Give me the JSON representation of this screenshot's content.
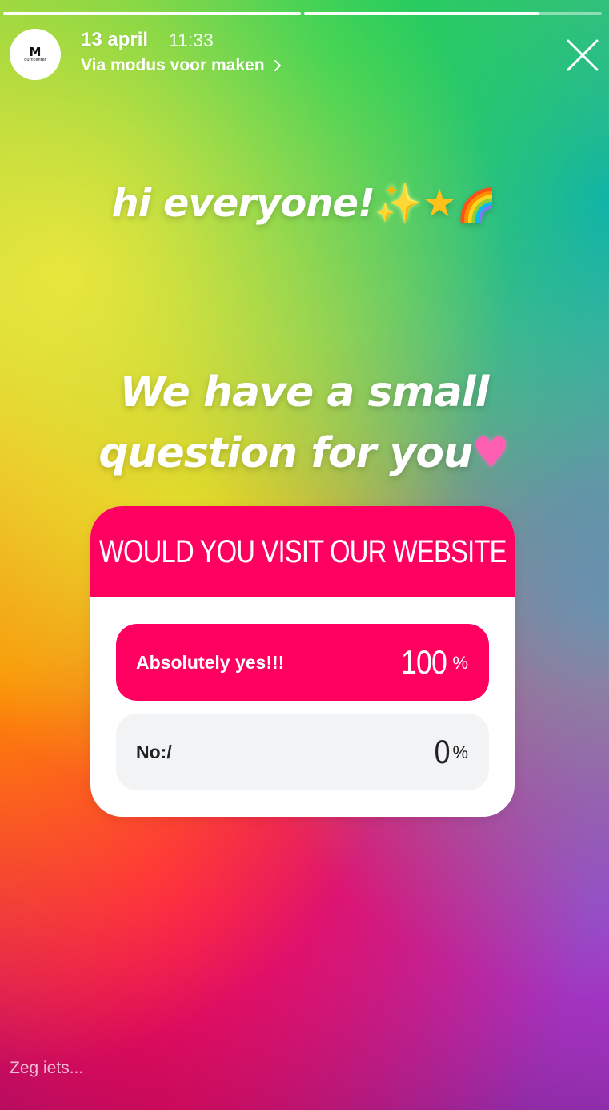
{
  "story": {
    "progress": [
      {
        "fraction": 1.0
      },
      {
        "fraction": 0.79
      }
    ]
  },
  "header": {
    "avatar_logo_mark": "M",
    "avatar_logo_text": "outncenter",
    "date": "13 april",
    "time": "11:33",
    "source": "Via modus voor maken",
    "close_icon": "close-icon"
  },
  "headlines": {
    "greeting": "hi everyone!",
    "greeting_emojis": [
      "✨",
      "★",
      "🌈"
    ],
    "question_line_1": "We have a small",
    "question_line_2": "question for you",
    "question_emoji": "♥"
  },
  "poll": {
    "question": "WOULD YOU VISIT OUR WEBSITE",
    "accent_color": "#ff0060",
    "options": [
      {
        "label": "Absolutely yes!!!",
        "percent": "100",
        "percent_sign": "%",
        "fraction": 1.0
      },
      {
        "label": "No:/",
        "percent": "0",
        "percent_sign": "%",
        "fraction": 0.0
      }
    ]
  },
  "footer": {
    "reply_placeholder": "Zeg iets..."
  }
}
